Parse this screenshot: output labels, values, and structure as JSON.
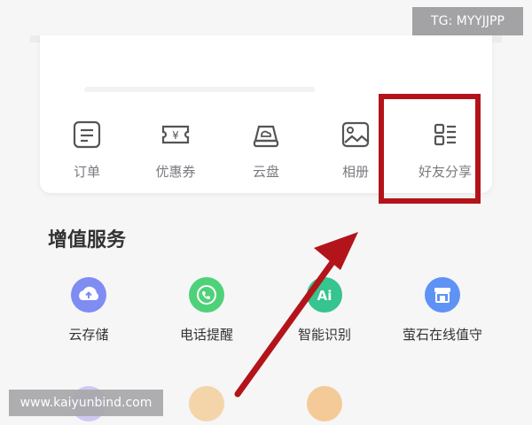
{
  "quick_actions": [
    {
      "label": "订单",
      "icon": "order-list-icon"
    },
    {
      "label": "优惠券",
      "icon": "coupon-icon"
    },
    {
      "label": "云盘",
      "icon": "cloud-drive-icon"
    },
    {
      "label": "相册",
      "icon": "photo-album-icon"
    },
    {
      "label": "好友分享",
      "icon": "friend-share-icon"
    }
  ],
  "section": {
    "title": "增值服务"
  },
  "services": [
    {
      "label": "云存储",
      "icon": "cloud-upload-icon",
      "color": "#7f8cf2"
    },
    {
      "label": "电话提醒",
      "icon": "phone-call-icon",
      "color": "#4fd17a"
    },
    {
      "label": "智能识别",
      "icon": "ai-recognition-icon",
      "color": "#36c48f"
    },
    {
      "label": "萤石在线值守",
      "icon": "online-guard-icon",
      "color": "#5e93f5"
    }
  ],
  "highlight_color": "#b3141a",
  "watermarks": {
    "top_right": "TG: MYYJJPP",
    "bottom_left": "www.kaiyunbind.com"
  }
}
